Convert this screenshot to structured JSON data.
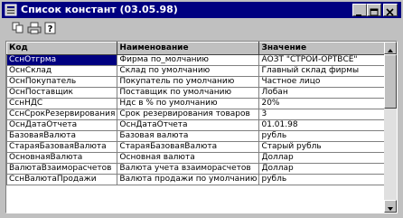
{
  "window": {
    "title": "Список констант (03.05.98)"
  },
  "grid": {
    "columns": [
      "Код",
      "Наименование",
      "Значение"
    ],
    "rows": [
      [
        "СснОтгрма",
        "Фирма по_молчанию",
        "АОЗТ \"СТРОЙ-ОРТВСЕ\""
      ],
      [
        "ОснСклад",
        "Склад по умолчанию",
        "Главный склад фирмы"
      ],
      [
        "ОснПокупатель",
        "Покупатель по умолчанию",
        "Частное лицо"
      ],
      [
        "ОснПоставщик",
        "Поставщик по умолчанию",
        "Лобан"
      ],
      [
        "СснНДС",
        "Ндс в % по умолчанию",
        "20%"
      ],
      [
        "СснСрокРезервирования",
        "Срок резервирования товаров",
        "3"
      ],
      [
        "ОснДатаОтчета",
        "ОснДатаОтчета",
        "01.01.98"
      ],
      [
        "БазоваяВалюта",
        "Базовая валюта",
        "рубль"
      ],
      [
        "СтараяБазоваяВалюта",
        "СтараяБазоваяВалюта",
        "Старый рубль"
      ],
      [
        "ОсновнаяВалюта",
        "Основная валюта",
        "Доллар"
      ],
      [
        "ВалютаВзаиморасчетов",
        "Валюта учета взаиморасчетов",
        "Доллар"
      ],
      [
        "СснВалютаПродажи",
        "Валюта продажи по умолчанию",
        "рубль"
      ]
    ]
  }
}
